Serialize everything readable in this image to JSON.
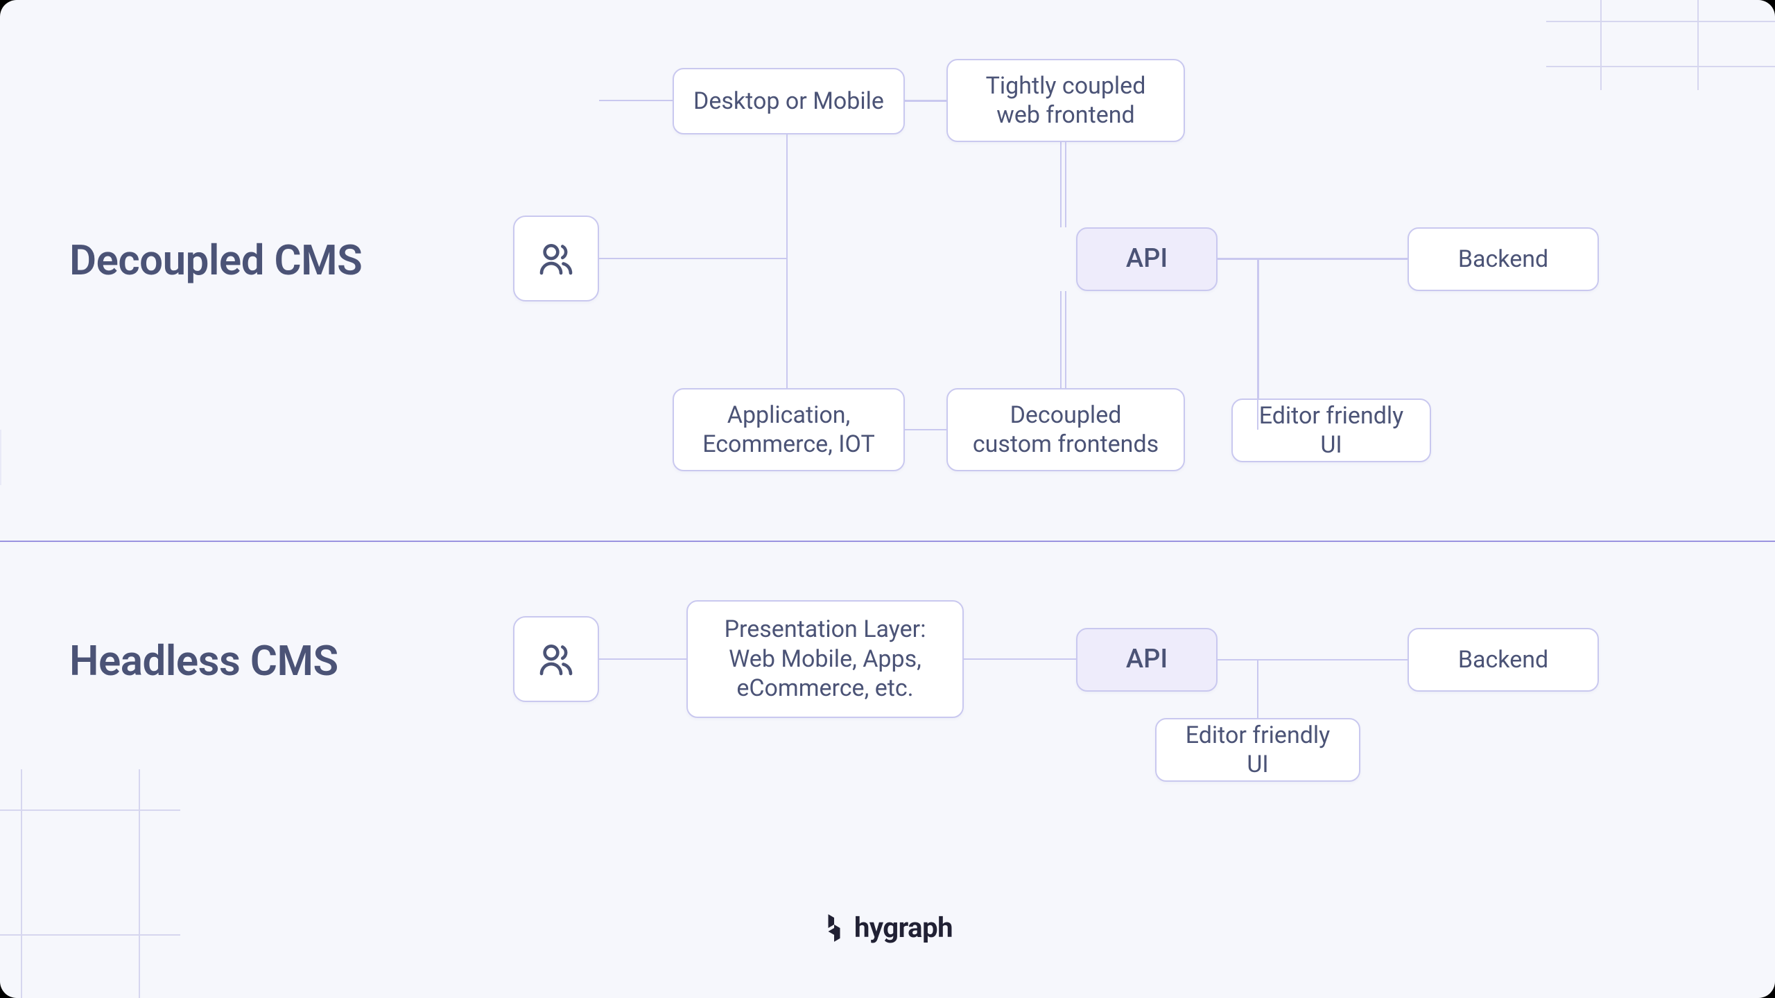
{
  "sections": {
    "decoupled": {
      "title": "Decoupled CMS",
      "nodes": {
        "desktop_mobile": "Desktop or Mobile",
        "tightly_coupled": "Tightly coupled\nweb frontend",
        "api": "API",
        "backend": "Backend",
        "app_iot": "Application,\nEcommerce, IOT",
        "decoupled_frontends": "Decoupled\ncustom frontends",
        "editor_ui": "Editor friendly UI"
      }
    },
    "headless": {
      "title": "Headless CMS",
      "nodes": {
        "presentation": "Presentation Layer:\nWeb Mobile, Apps,\neCommerce, etc.",
        "api": "API",
        "backend": "Backend",
        "editor_ui": "Editor friendly UI"
      }
    }
  },
  "brand": "hygraph"
}
